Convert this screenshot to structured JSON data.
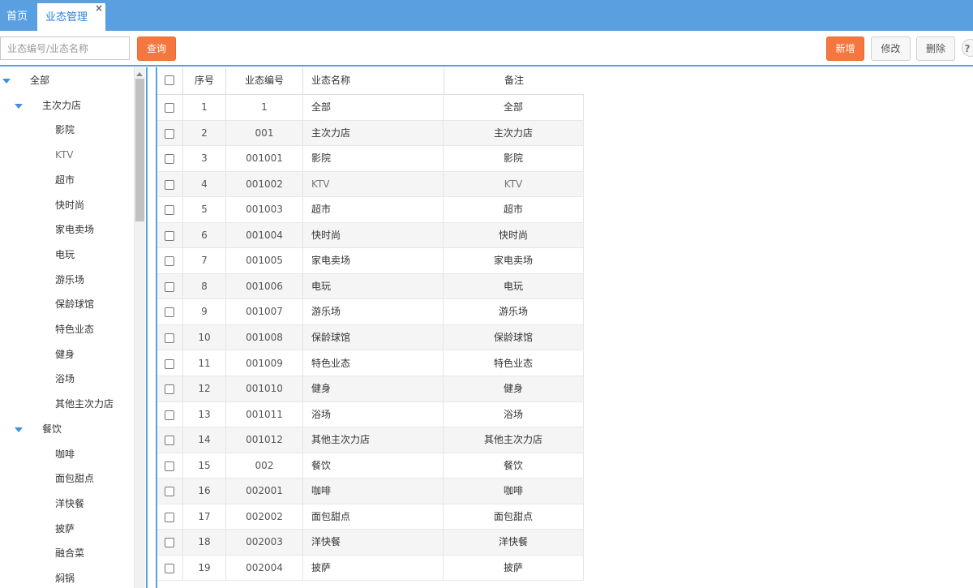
{
  "tabs": [
    {
      "label": "首页",
      "active": false
    },
    {
      "label": "业态管理",
      "active": true
    }
  ],
  "tab_close_icon": "×",
  "search": {
    "placeholder": "业态编号/业态名称",
    "value": ""
  },
  "toolbar": {
    "query_label": "查询",
    "add_label": "新增",
    "edit_label": "修改",
    "delete_label": "删除",
    "help_icon": "?"
  },
  "colors": {
    "accent": "#5aa0e0",
    "orange": "#f4773f"
  },
  "tree": {
    "root": "全部",
    "groups": [
      {
        "label": "主次力店",
        "children": [
          "影院",
          "KTV",
          "超市",
          "快时尚",
          "家电卖场",
          "电玩",
          "游乐场",
          "保龄球馆",
          "特色业态",
          "健身",
          "浴场",
          "其他主次力店"
        ]
      },
      {
        "label": "餐饮",
        "children": [
          "咖啡",
          "面包甜点",
          "洋快餐",
          "披萨",
          "融合菜",
          "焖锅"
        ]
      }
    ]
  },
  "table": {
    "columns": [
      "序号",
      "业态编号",
      "业态名称",
      "备注"
    ],
    "rows": [
      [
        "1",
        "1",
        "全部",
        "全部"
      ],
      [
        "2",
        "001",
        "主次力店",
        "主次力店"
      ],
      [
        "3",
        "001001",
        "影院",
        "影院"
      ],
      [
        "4",
        "001002",
        "KTV",
        "KTV"
      ],
      [
        "5",
        "001003",
        "超市",
        "超市"
      ],
      [
        "6",
        "001004",
        "快时尚",
        "快时尚"
      ],
      [
        "7",
        "001005",
        "家电卖场",
        "家电卖场"
      ],
      [
        "8",
        "001006",
        "电玩",
        "电玩"
      ],
      [
        "9",
        "001007",
        "游乐场",
        "游乐场"
      ],
      [
        "10",
        "001008",
        "保龄球馆",
        "保龄球馆"
      ],
      [
        "11",
        "001009",
        "特色业态",
        "特色业态"
      ],
      [
        "12",
        "001010",
        "健身",
        "健身"
      ],
      [
        "13",
        "001011",
        "浴场",
        "浴场"
      ],
      [
        "14",
        "001012",
        "其他主次力店",
        "其他主次力店"
      ],
      [
        "15",
        "002",
        "餐饮",
        "餐饮"
      ],
      [
        "16",
        "002001",
        "咖啡",
        "咖啡"
      ],
      [
        "17",
        "002002",
        "面包甜点",
        "面包甜点"
      ],
      [
        "18",
        "002003",
        "洋快餐",
        "洋快餐"
      ],
      [
        "19",
        "002004",
        "披萨",
        "披萨"
      ]
    ]
  }
}
